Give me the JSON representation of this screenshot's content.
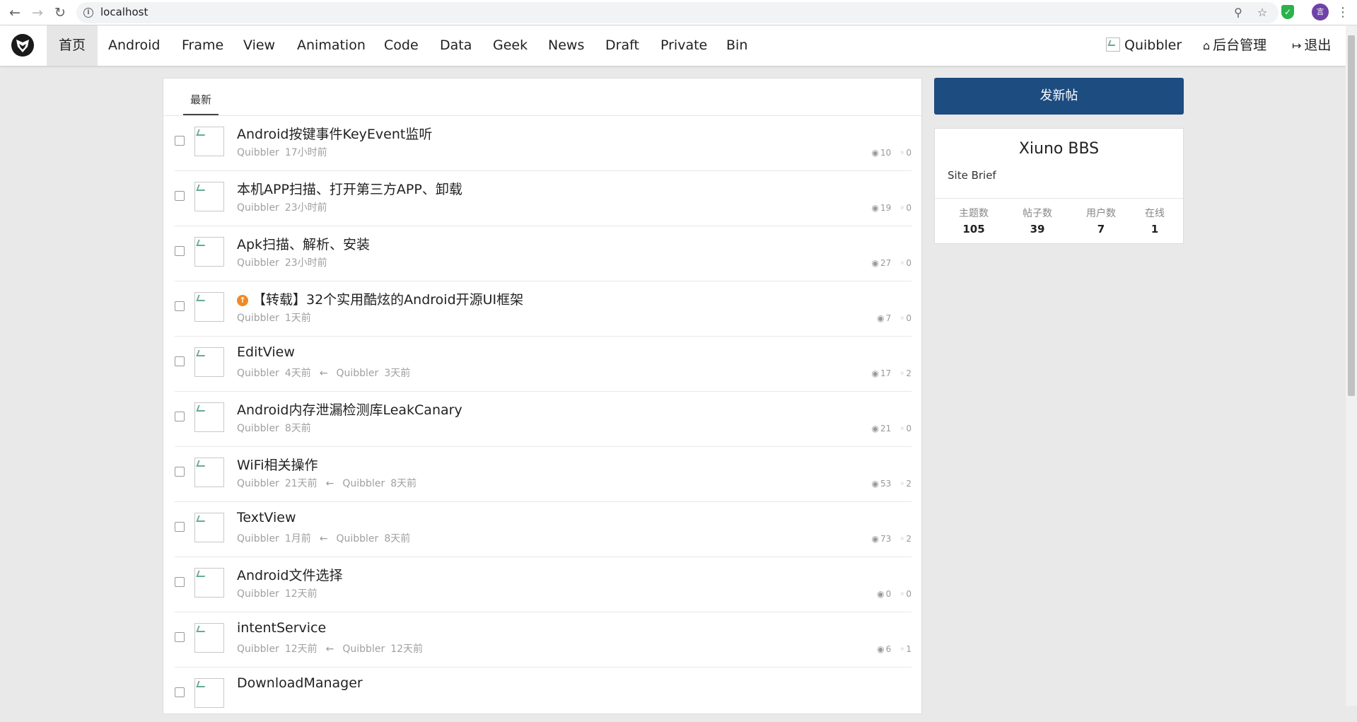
{
  "browser": {
    "url": "localhost",
    "profile_initial": "言"
  },
  "navbar": {
    "items": [
      {
        "label": "首页",
        "active": true
      },
      {
        "label": "Android"
      },
      {
        "label": "Frame"
      },
      {
        "label": "View"
      },
      {
        "label": "Animation"
      },
      {
        "label": "Code"
      },
      {
        "label": "Data"
      },
      {
        "label": "Geek"
      },
      {
        "label": "News"
      },
      {
        "label": "Draft"
      },
      {
        "label": "Private"
      },
      {
        "label": "Bin"
      }
    ],
    "user": "Quibbler",
    "admin": "后台管理",
    "logout": "退出"
  },
  "main": {
    "tab_latest": "最新",
    "threads": [
      {
        "title": "Android按键事件KeyEvent监听",
        "author": "Quibbler",
        "time": "17小时前",
        "views": "10",
        "comments": "0"
      },
      {
        "title": "本机APP扫描、打开第三方APP、卸载",
        "author": "Quibbler",
        "time": "23小时前",
        "views": "19",
        "comments": "0"
      },
      {
        "title": "Apk扫描、解析、安装",
        "author": "Quibbler",
        "time": "23小时前",
        "views": "27",
        "comments": "0"
      },
      {
        "title": "【转载】32个实用酷炫的Android开源UI框架",
        "author": "Quibbler",
        "time": "1天前",
        "views": "7",
        "comments": "0",
        "top": true
      },
      {
        "title": "EditView",
        "author": "Quibbler",
        "time": "4天前",
        "last_author": "Quibbler",
        "last_time": "3天前",
        "views": "17",
        "comments": "2"
      },
      {
        "title": "Android内存泄漏检测库LeakCanary",
        "author": "Quibbler",
        "time": "8天前",
        "views": "21",
        "comments": "0"
      },
      {
        "title": "WiFi相关操作",
        "author": "Quibbler",
        "time": "21天前",
        "last_author": "Quibbler",
        "last_time": "8天前",
        "views": "53",
        "comments": "2"
      },
      {
        "title": "TextView",
        "author": "Quibbler",
        "time": "1月前",
        "last_author": "Quibbler",
        "last_time": "8天前",
        "views": "73",
        "comments": "2"
      },
      {
        "title": "Android文件选择",
        "author": "Quibbler",
        "time": "12天前",
        "views": "0",
        "comments": "0"
      },
      {
        "title": "intentService",
        "author": "Quibbler",
        "time": "12天前",
        "last_author": "Quibbler",
        "last_time": "12天前",
        "views": "6",
        "comments": "1"
      },
      {
        "title": "DownloadManager",
        "author": "",
        "time": "",
        "views": "",
        "comments": ""
      }
    ]
  },
  "sidebar": {
    "post_button": "发新帖",
    "site_name": "Xiuno BBS",
    "site_brief": "Site Brief",
    "stats": [
      {
        "label": "主题数",
        "value": "105"
      },
      {
        "label": "帖子数",
        "value": "39"
      },
      {
        "label": "用户数",
        "value": "7"
      },
      {
        "label": "在线",
        "value": "1"
      }
    ]
  }
}
